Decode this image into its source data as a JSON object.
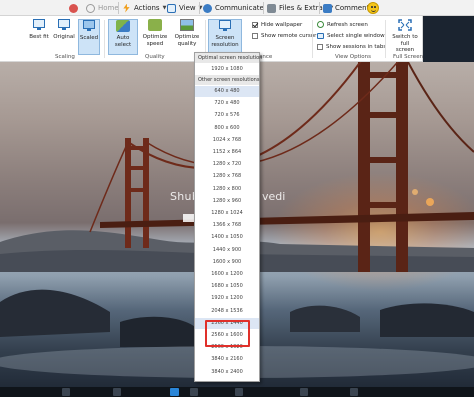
{
  "menubar": {
    "home": "Home",
    "actions": "Actions",
    "view": "View",
    "communicate": "Communicate",
    "files_extras": "Files & Extras",
    "comment": "Comment"
  },
  "ribbon": {
    "scaling": {
      "best_fit": "Best fit",
      "original": "Original",
      "scaled": "Scaled",
      "label": "Scaling"
    },
    "quality": {
      "auto_select": "Auto select",
      "optimize_speed_1": "Optimize",
      "optimize_speed_2": "speed",
      "optimize_quality_1": "Optimize",
      "optimize_quality_2": "quality",
      "label": "Quality"
    },
    "resolution": {
      "line1": "Screen",
      "line2": "resolution",
      "label_tail": "ence"
    },
    "view_toggles": {
      "hide_wallpaper": "Hide wallpaper",
      "hide_wallpaper_checked": true,
      "show_remote_cursor": "Show remote cursor",
      "show_remote_cursor_checked": false
    },
    "view_options": {
      "refresh_screen": "Refresh screen",
      "select_single_window": "Select single window",
      "show_sessions_in_tabs": "Show sessions in tabs",
      "label": "View Options"
    },
    "full_screen": {
      "line1": "Switch to full",
      "line2": "screen",
      "label": "Full Screen"
    }
  },
  "desktop": {
    "username_head": "Shub",
    "username_tail": "vedi"
  },
  "resolution_menu": {
    "optimal_header": "Optimal screen resolution",
    "optimal_value": "1920 x 1080",
    "other_header": "Other screen resolutions",
    "items": [
      "640 x 480",
      "720 x 480",
      "720 x 576",
      "800 x 600",
      "1024 x 768",
      "1152 x 864",
      "1280 x 720",
      "1280 x 768",
      "1280 x 800",
      "1280 x 960",
      "1280 x 1024",
      "1366 x 768",
      "1400 x 1050",
      "1440 x 900",
      "1600 x 900",
      "1600 x 1200",
      "1680 x 1050",
      "1920 x 1200",
      "2048 x 1536",
      "2560 x 1440",
      "2560 x 1600",
      "2560 x 1920",
      "3840 x 2160",
      "3840 x 2400"
    ],
    "highlighted_items": [
      "640 x 480",
      "2560 x 1440"
    ],
    "marked_items": [
      "2560 x 1600",
      "2560 x 1920"
    ]
  },
  "colors": {
    "accent_blue": "#2a6fb5",
    "highlight": "#cde3f7",
    "red_marker": "#e0302a"
  }
}
